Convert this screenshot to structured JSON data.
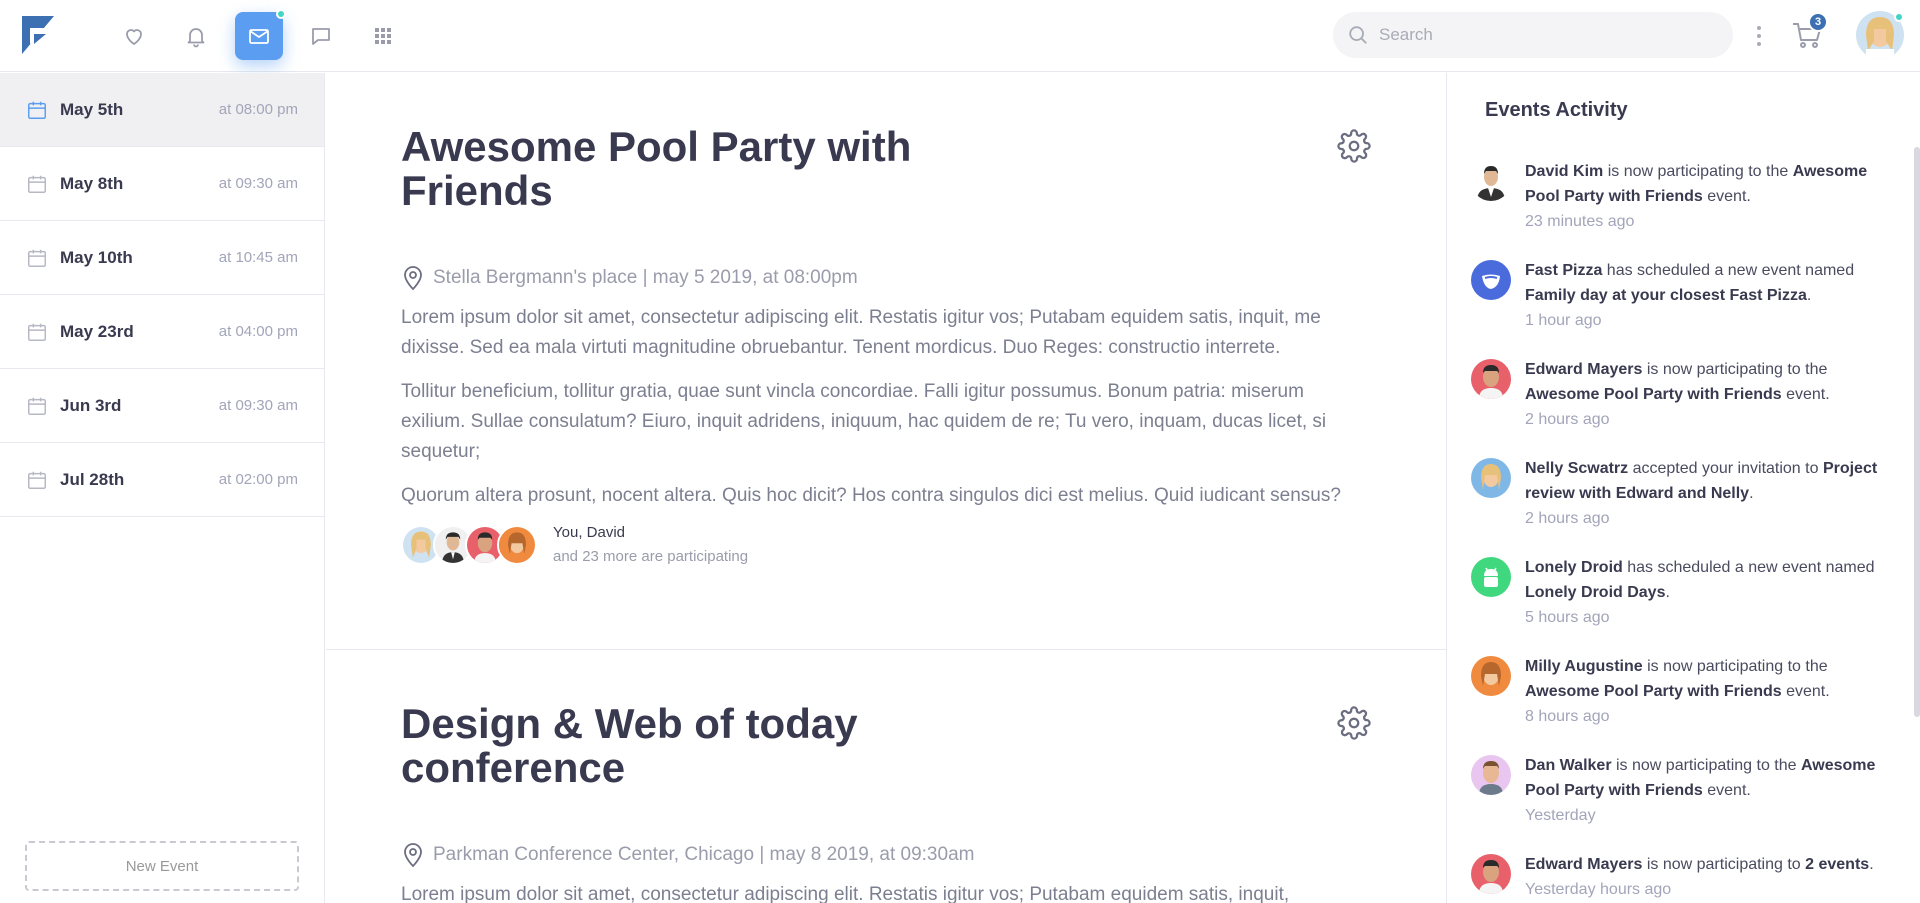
{
  "topbar": {
    "search_placeholder": "Search",
    "cart_count": "3",
    "nav": [
      {
        "name": "heart-icon"
      },
      {
        "name": "bell-icon"
      },
      {
        "name": "mail-icon",
        "active": true
      },
      {
        "name": "chat-icon"
      },
      {
        "name": "grid-icon"
      }
    ]
  },
  "sidebar": {
    "dates": [
      {
        "label": "May 5th",
        "time": "at 08:00 pm",
        "active": true
      },
      {
        "label": "May 8th",
        "time": "at 09:30 am"
      },
      {
        "label": "May 10th",
        "time": "at 10:45 am"
      },
      {
        "label": "May 23rd",
        "time": "at 04:00 pm"
      },
      {
        "label": "Jun 3rd",
        "time": "at 09:30 am"
      },
      {
        "label": "Jul 28th",
        "time": "at 02:00 pm"
      }
    ],
    "new_event_label": "New Event"
  },
  "events": [
    {
      "title": "Awesome Pool Party with Friends",
      "location": "Stella Bergmann's place | may 5 2019, at 08:00pm",
      "paragraphs": [
        "Lorem ipsum dolor sit amet, consectetur adipiscing elit. Restatis igitur vos; Putabam equidem satis, inquit, me dixisse. Sed ea mala virtuti magnitudine obruebantur. Tenent mordicus. Duo Reges: constructio interrete.",
        "Tollitur beneficium, tollitur gratia, quae sunt vincla concordiae. Falli igitur possumus. Bonum patria: miserum exilium. Sullae consulatum? Eiuro, inquit adridens, iniquum, hac quidem de re; Tu vero, inquam, ducas licet, si sequetur;",
        "Quorum altera prosunt, nocent altera. Quis hoc dicit? Hos contra singulos dici est melius. Quid iudicant sensus?"
      ],
      "participants_who": "You, David",
      "participants_more": "and 23 more are participating"
    },
    {
      "title": "Design & Web of today conference",
      "location": "Parkman Conference Center, Chicago | may 8 2019, at 09:30am",
      "paragraphs": [
        "Lorem ipsum dolor sit amet, consectetur adipiscing elit. Restatis igitur vos; Putabam equidem satis, inquit,"
      ]
    }
  ],
  "activity": {
    "title": "Events Activity",
    "items": [
      {
        "actor": "David Kim",
        "text": " is now participating to the ",
        "target": "Awesome Pool Party with Friends",
        "tail": " event.",
        "time": "23 minutes ago",
        "avatar_color": "#e8e8ee"
      },
      {
        "actor": "Fast Pizza",
        "text": " has scheduled a new event named ",
        "target": "Family day at your closest Fast Pizza",
        "tail": ".",
        "time": "1 hour ago",
        "avatar_color": "#4a6bdc"
      },
      {
        "actor": "Edward Mayers",
        "text": " is now participating to the ",
        "target": "Awesome Pool Party with Friends",
        "tail": " event.",
        "time": "2 hours ago",
        "avatar_color": "#e8606a"
      },
      {
        "actor": "Nelly Scwatrz",
        "text": " accepted your invitation to ",
        "target": "Project review with Edward and Nelly",
        "tail": ".",
        "time": "2 hours ago",
        "avatar_color": "#7fb8e6"
      },
      {
        "actor": "Lonely Droid",
        "text": " has scheduled a new event named ",
        "target": "Lonely Droid Days",
        "tail": ".",
        "time": "5 hours ago",
        "avatar_color": "#3fd87e"
      },
      {
        "actor": "Milly Augustine",
        "text": " is now participating to the ",
        "target": "Awesome Pool Party with Friends",
        "tail": " event.",
        "time": "8 hours ago",
        "avatar_color": "#f08a3e"
      },
      {
        "actor": "Dan Walker",
        "text": " is now participating to the ",
        "target": "Awesome Pool Party with Friends",
        "tail": " event.",
        "time": "Yesterday",
        "avatar_color": "#e9c6f0"
      },
      {
        "actor": "Edward Mayers",
        "text": " is now participating to ",
        "target": "2 events",
        "tail": ".",
        "time": "Yesterday hours ago",
        "avatar_color": "#e8606a"
      }
    ]
  }
}
